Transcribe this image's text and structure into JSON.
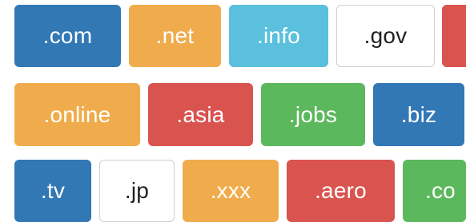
{
  "tags": {
    "row1": [
      ".com",
      ".net",
      ".info",
      ".gov",
      ""
    ],
    "row2": [
      ".online",
      ".asia",
      ".jobs",
      ".biz"
    ],
    "row3": [
      ".tv",
      ".jp",
      ".xxx",
      ".aero",
      ".co"
    ]
  },
  "colors": {
    "blue": "#3278b5",
    "orange": "#f0ac4c",
    "cyan": "#5ac0dd",
    "white": "#ffffff",
    "red": "#d9534f",
    "green": "#5cb85c"
  }
}
